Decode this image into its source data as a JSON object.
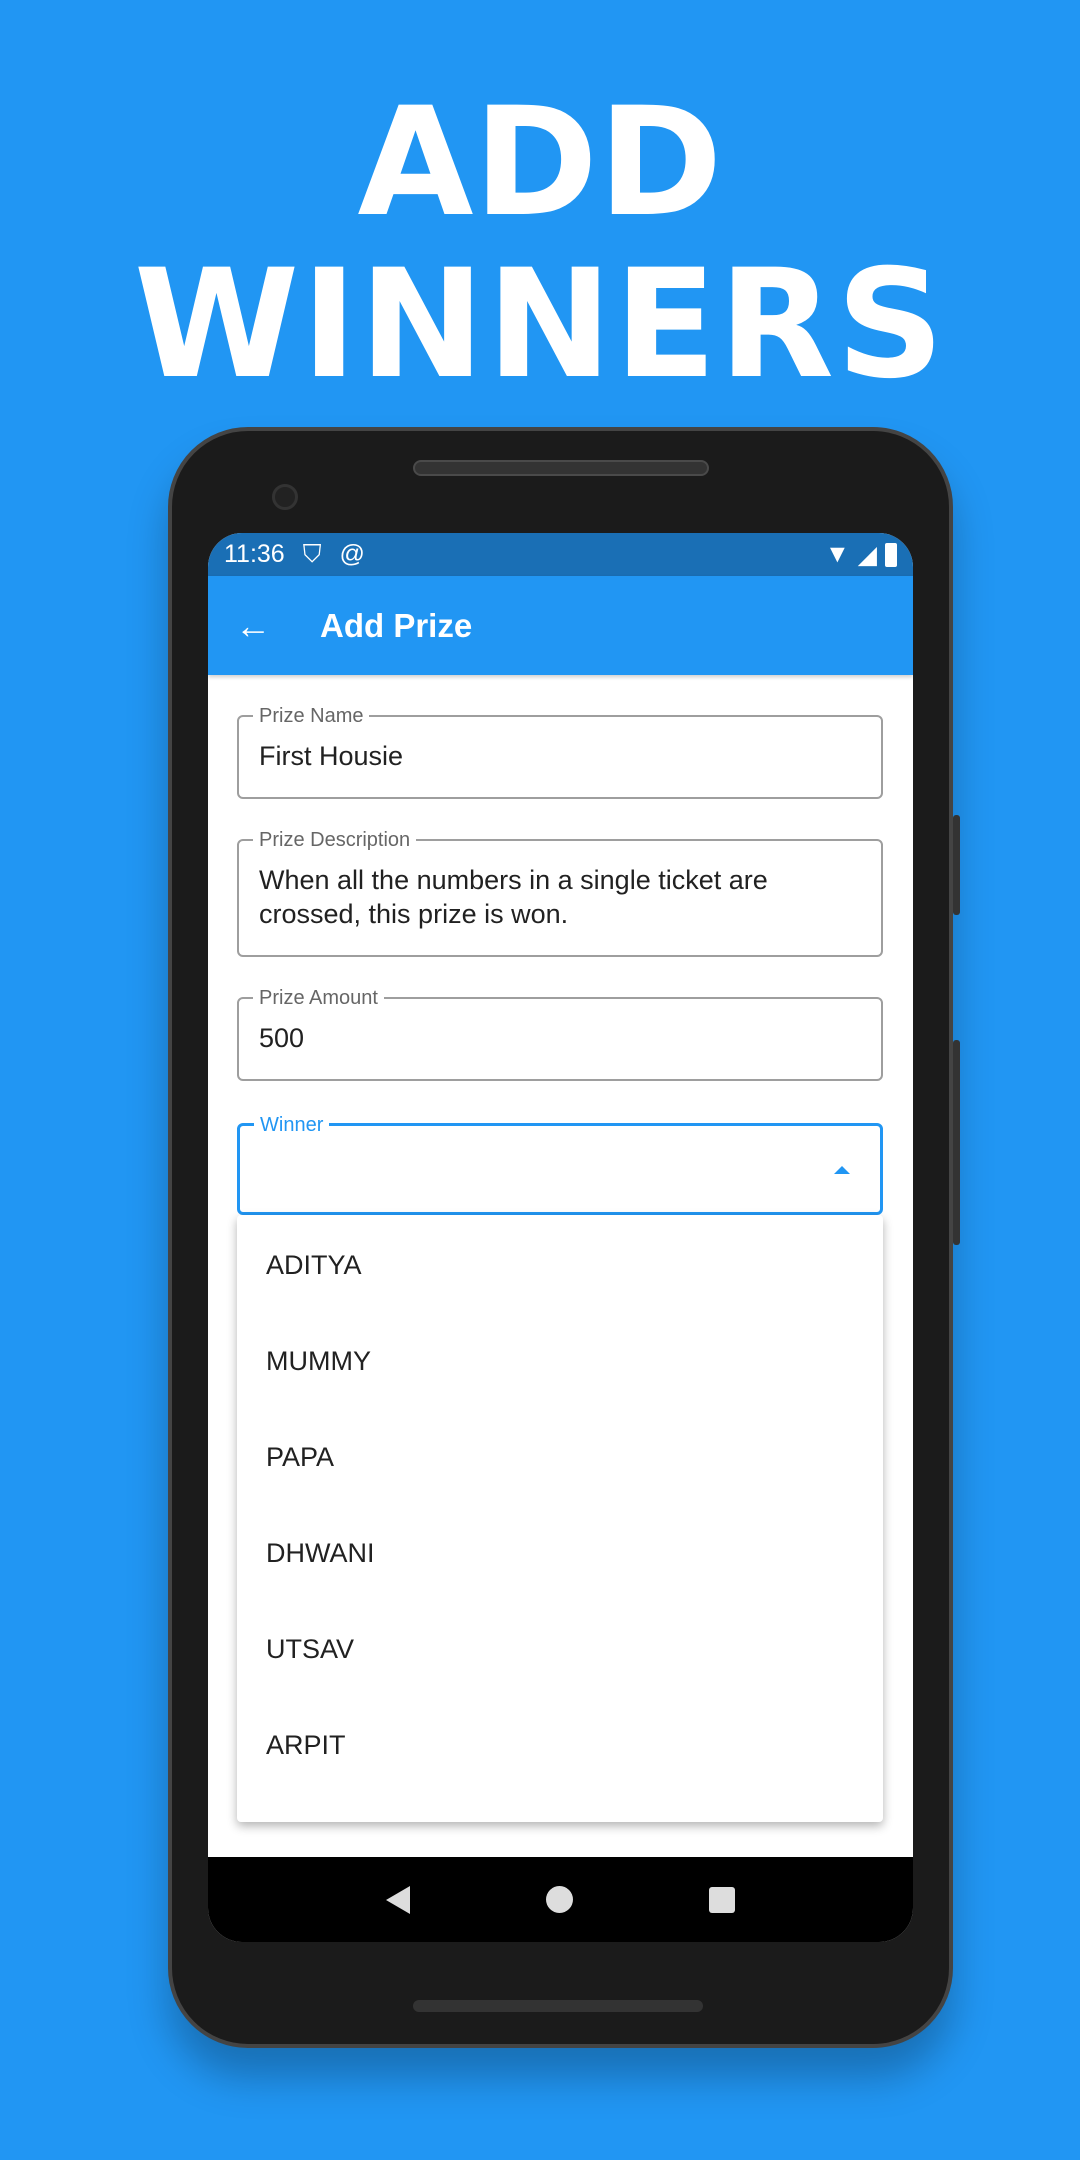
{
  "headline": {
    "line1": "ADD",
    "line2": "WINNERS"
  },
  "status_bar": {
    "time": "11:36",
    "icons": [
      "shield-play-icon",
      "at-sign-icon",
      "wifi-icon",
      "signal-icon",
      "battery-icon"
    ]
  },
  "app_bar": {
    "title": "Add Prize",
    "back_icon": "arrow-left-icon"
  },
  "form": {
    "prize_name": {
      "label": "Prize Name",
      "value": "First Housie"
    },
    "prize_description": {
      "label": "Prize Description",
      "value": "When all the numbers in a single ticket are crossed, this prize is won."
    },
    "prize_amount": {
      "label": "Prize Amount",
      "value": "500"
    },
    "winner": {
      "label": "Winner",
      "value": "",
      "options": [
        "ADITYA",
        "MUMMY",
        "PAPA",
        "DHWANI",
        "UTSAV",
        "ARPIT"
      ]
    }
  },
  "colors": {
    "background": "#2196F3",
    "app_bar": "#2196F3",
    "status_bar": "#1A6FB5"
  }
}
